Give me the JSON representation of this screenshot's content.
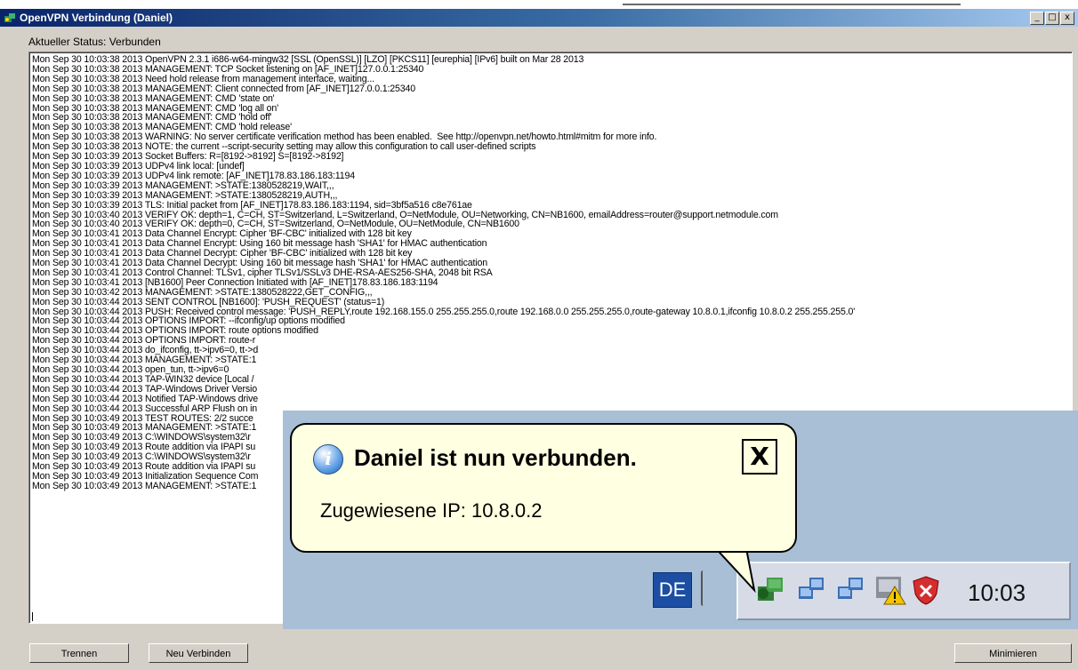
{
  "window": {
    "title": "OpenVPN Verbindung (Daniel)",
    "caption_buttons": [
      "_",
      "□",
      "x"
    ],
    "status": "Aktueller Status: Verbunden"
  },
  "log": [
    "Mon Sep 30 10:03:38 2013 OpenVPN 2.3.1 i686-w64-mingw32 [SSL (OpenSSL)] [LZO] [PKCS11] [eurephia] [IPv6] built on Mar 28 2013",
    "Mon Sep 30 10:03:38 2013 MANAGEMENT: TCP Socket listening on [AF_INET]127.0.0.1:25340",
    "Mon Sep 30 10:03:38 2013 Need hold release from management interface, waiting...",
    "Mon Sep 30 10:03:38 2013 MANAGEMENT: Client connected from [AF_INET]127.0.0.1:25340",
    "Mon Sep 30 10:03:38 2013 MANAGEMENT: CMD 'state on'",
    "Mon Sep 30 10:03:38 2013 MANAGEMENT: CMD 'log all on'",
    "Mon Sep 30 10:03:38 2013 MANAGEMENT: CMD 'hold off'",
    "Mon Sep 30 10:03:38 2013 MANAGEMENT: CMD 'hold release'",
    "Mon Sep 30 10:03:38 2013 WARNING: No server certificate verification method has been enabled.  See http://openvpn.net/howto.html#mitm for more info.",
    "Mon Sep 30 10:03:38 2013 NOTE: the current --script-security setting may allow this configuration to call user-defined scripts",
    "Mon Sep 30 10:03:39 2013 Socket Buffers: R=[8192->8192] S=[8192->8192]",
    "Mon Sep 30 10:03:39 2013 UDPv4 link local: [undef]",
    "Mon Sep 30 10:03:39 2013 UDPv4 link remote: [AF_INET]178.83.186.183:1194",
    "Mon Sep 30 10:03:39 2013 MANAGEMENT: >STATE:1380528219,WAIT,,,",
    "Mon Sep 30 10:03:39 2013 MANAGEMENT: >STATE:1380528219,AUTH,,,",
    "Mon Sep 30 10:03:39 2013 TLS: Initial packet from [AF_INET]178.83.186.183:1194, sid=3bf5a516 c8e761ae",
    "Mon Sep 30 10:03:40 2013 VERIFY OK: depth=1, C=CH, ST=Switzerland, L=Switzerland, O=NetModule, OU=Networking, CN=NB1600, emailAddress=router@support.netmodule.com",
    "Mon Sep 30 10:03:40 2013 VERIFY OK: depth=0, C=CH, ST=Switzerland, O=NetModule, OU=NetModule, CN=NB1600",
    "Mon Sep 30 10:03:41 2013 Data Channel Encrypt: Cipher 'BF-CBC' initialized with 128 bit key",
    "Mon Sep 30 10:03:41 2013 Data Channel Encrypt: Using 160 bit message hash 'SHA1' for HMAC authentication",
    "Mon Sep 30 10:03:41 2013 Data Channel Decrypt: Cipher 'BF-CBC' initialized with 128 bit key",
    "Mon Sep 30 10:03:41 2013 Data Channel Decrypt: Using 160 bit message hash 'SHA1' for HMAC authentication",
    "Mon Sep 30 10:03:41 2013 Control Channel: TLSv1, cipher TLSv1/SSLv3 DHE-RSA-AES256-SHA, 2048 bit RSA",
    "Mon Sep 30 10:03:41 2013 [NB1600] Peer Connection Initiated with [AF_INET]178.83.186.183:1194",
    "Mon Sep 30 10:03:42 2013 MANAGEMENT: >STATE:1380528222,GET_CONFIG,,,",
    "Mon Sep 30 10:03:44 2013 SENT CONTROL [NB1600]: 'PUSH_REQUEST' (status=1)",
    "Mon Sep 30 10:03:44 2013 PUSH: Received control message: 'PUSH_REPLY,route 192.168.155.0 255.255.255.0,route 192.168.0.0 255.255.255.0,route-gateway 10.8.0.1,ifconfig 10.8.0.2 255.255.255.0'",
    "Mon Sep 30 10:03:44 2013 OPTIONS IMPORT: --ifconfig/up options modified",
    "Mon Sep 30 10:03:44 2013 OPTIONS IMPORT: route options modified",
    "Mon Sep 30 10:03:44 2013 OPTIONS IMPORT: route-r",
    "Mon Sep 30 10:03:44 2013 do_ifconfig, tt->ipv6=0, tt->d",
    "Mon Sep 30 10:03:44 2013 MANAGEMENT: >STATE:1",
    "Mon Sep 30 10:03:44 2013 open_tun, tt->ipv6=0",
    "Mon Sep 30 10:03:44 2013 TAP-WIN32 device [Local /",
    "Mon Sep 30 10:03:44 2013 TAP-Windows Driver Versio",
    "Mon Sep 30 10:03:44 2013 Notified TAP-Windows drive",
    "Mon Sep 30 10:03:44 2013 Successful ARP Flush on in",
    "Mon Sep 30 10:03:49 2013 TEST ROUTES: 2/2 succe",
    "Mon Sep 30 10:03:49 2013 MANAGEMENT: >STATE:1",
    "Mon Sep 30 10:03:49 2013 C:\\WINDOWS\\system32\\r",
    "Mon Sep 30 10:03:49 2013 Route addition via IPAPI su",
    "Mon Sep 30 10:03:49 2013 C:\\WINDOWS\\system32\\r",
    "Mon Sep 30 10:03:49 2013 Route addition via IPAPI su",
    "Mon Sep 30 10:03:49 2013 Initialization Sequence Com",
    "Mon Sep 30 10:03:49 2013 MANAGEMENT: >STATE:1"
  ],
  "buttons": {
    "disconnect": "Trennen",
    "reconnect": "Neu Verbinden",
    "minimize": "Minimieren"
  },
  "notification": {
    "title": "Daniel ist nun verbunden.",
    "body": "Zugewiesene IP: 10.8.0.2",
    "close": "X"
  },
  "taskbar": {
    "language": "DE",
    "clock": "10:03"
  },
  "colors": {
    "titlebar": "#0a246a",
    "balloon": "#ffffe1",
    "language_badge": "#1c4fa3"
  }
}
